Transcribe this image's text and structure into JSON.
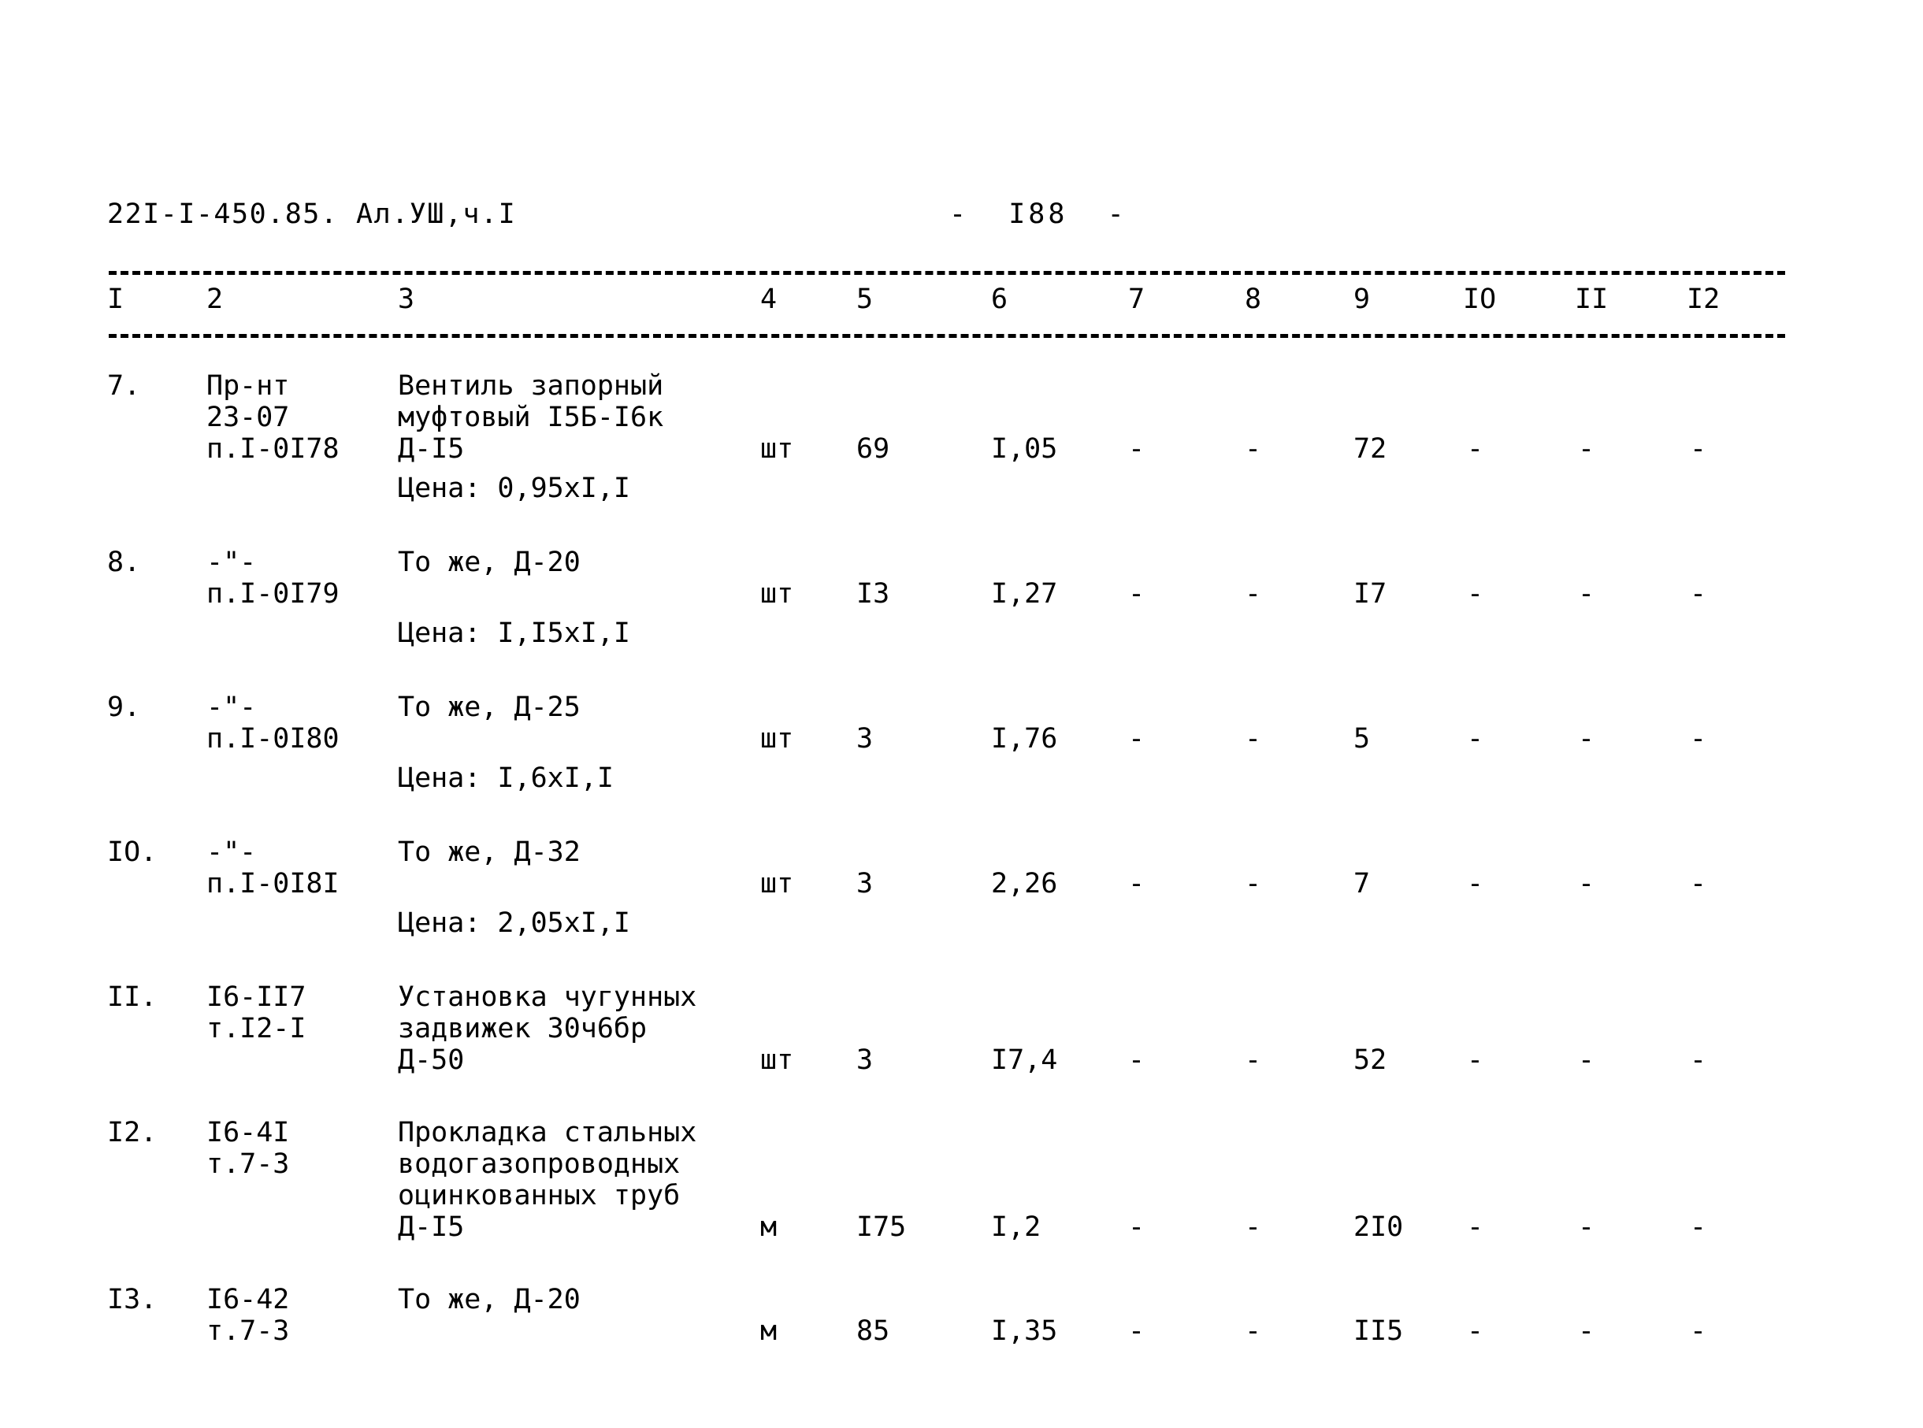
{
  "document": {
    "code": "22I-I-450.85. Ал.УШ,ч.I",
    "page_label": "-  I88  -"
  },
  "table": {
    "column_numbers": [
      "I",
      "2",
      "3",
      "4",
      "5",
      "6",
      "7",
      "8",
      "9",
      "IO",
      "II",
      "I2"
    ],
    "rows": [
      {
        "num": "7.",
        "code": "Пр-нт\n23-07\nп.I-0I78",
        "name": "Вентиль запорный\nмуфтовый I5Б-I6к\nД-I5",
        "price_note": "Цена: 0,95хI,I",
        "unit": "шт",
        "qty": "69",
        "price": "I,05",
        "c7": "-",
        "c8": "-",
        "c9": "72",
        "c10": "-",
        "c11": "-",
        "c12": "-"
      },
      {
        "num": "8.",
        "code": "-\"-\nп.I-0I79",
        "name": "То же, Д-20",
        "price_note": "Цена: I,I5хI,I",
        "unit": "шт",
        "qty": "I3",
        "price": "I,27",
        "c7": "-",
        "c8": "-",
        "c9": "I7",
        "c10": "-",
        "c11": "-",
        "c12": "-"
      },
      {
        "num": "9.",
        "code": "-\"-\nп.I-0I80",
        "name": "То же, Д-25",
        "price_note": "Цена: I,6хI,I",
        "unit": "шт",
        "qty": "3",
        "price": "I,76",
        "c7": "-",
        "c8": "-",
        "c9": "5",
        "c10": "-",
        "c11": "-",
        "c12": "-"
      },
      {
        "num": "IO.",
        "code": "-\"-\nп.I-0I8I",
        "name": "То же, Д-32",
        "price_note": "Цена: 2,05хI,I",
        "unit": "шт",
        "qty": "3",
        "price": "2,26",
        "c7": "-",
        "c8": "-",
        "c9": "7",
        "c10": "-",
        "c11": "-",
        "c12": "-"
      },
      {
        "num": "II.",
        "code": "I6-II7\nт.I2-I",
        "name": "Установка чугунных\nзадвижек 30ч6бр\nД-50",
        "price_note": "",
        "unit": "шт",
        "qty": "3",
        "price": "I7,4",
        "c7": "-",
        "c8": "-",
        "c9": "52",
        "c10": "-",
        "c11": "-",
        "c12": "-"
      },
      {
        "num": "I2.",
        "code": "I6-4I\nт.7-3",
        "name": "Прокладка стальных\nводогазопроводных\nоцинкованных труб\nД-I5",
        "price_note": "",
        "unit": "м",
        "qty": "I75",
        "price": "I,2",
        "c7": "-",
        "c8": "-",
        "c9": "2I0",
        "c10": "-",
        "c11": "-",
        "c12": "-"
      },
      {
        "num": "I3.",
        "code": "I6-42\nт.7-3",
        "name": "То же, Д-20",
        "price_note": "",
        "unit": "м",
        "qty": "85",
        "price": "I,35",
        "c7": "-",
        "c8": "-",
        "c9": "II5",
        "c10": "-",
        "c11": "-",
        "c12": "-"
      }
    ]
  }
}
